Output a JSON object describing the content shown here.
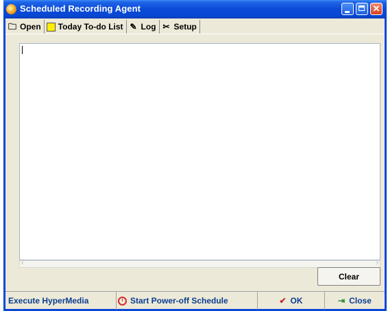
{
  "window": {
    "title": "Scheduled Recording Agent"
  },
  "tabs": [
    {
      "label": "Open",
      "icon": "folder-icon"
    },
    {
      "label": "Today To-do List",
      "icon": "note-icon"
    },
    {
      "label": "Log",
      "icon": "log-icon",
      "active": true
    },
    {
      "label": "Setup",
      "icon": "tools-icon"
    }
  ],
  "log": {
    "content": ""
  },
  "buttons": {
    "clear": "Clear"
  },
  "bottom_bar": {
    "execute": "Execute HyperMedia",
    "power_off": "Start Power-off Schedule",
    "ok": "OK",
    "close": "Close"
  },
  "colors": {
    "title_bar": "#0a4bd8",
    "client_bg": "#ece9d8",
    "bottom_text": "#0a3d91"
  }
}
